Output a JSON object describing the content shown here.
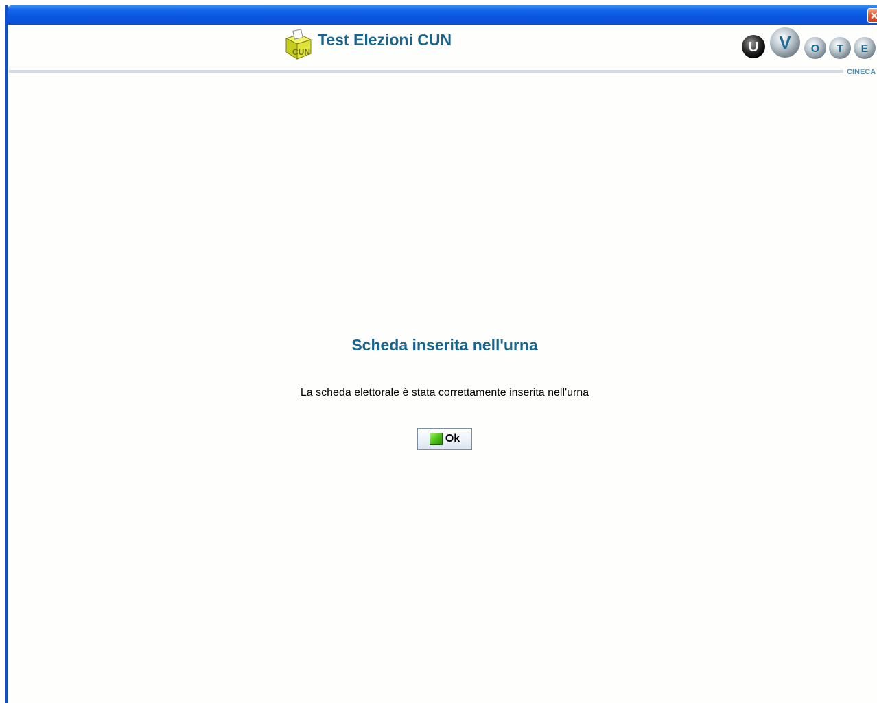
{
  "window": {
    "close_glyph": "✕"
  },
  "header": {
    "title": "Test Elezioni CUN",
    "logo_icon": "ballot-box-icon",
    "logo_text": "CUN",
    "brand": {
      "letters": [
        "U",
        "V",
        "O",
        "T",
        "E"
      ],
      "subtitle": "CINECA"
    }
  },
  "main": {
    "heading": "Scheda inserita nell'urna",
    "message": "La scheda elettorale è stata correttamente inserita nell'urna",
    "ok_button": {
      "label": "Ok",
      "icon": "green-square-icon"
    }
  },
  "colors": {
    "title_blue": "#17658f",
    "titlebar_blue": "#0a55de",
    "accent_green": "#4cc21a",
    "close_red": "#e0603b"
  }
}
